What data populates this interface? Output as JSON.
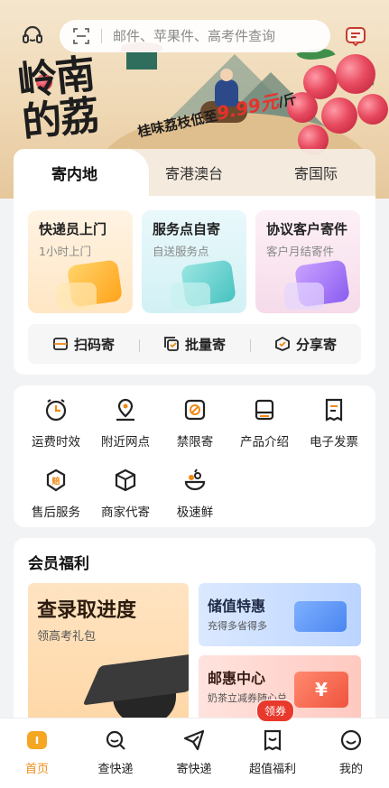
{
  "banner": {
    "title": "岭南的荔",
    "slogan": "桂味荔枝低至",
    "price": "9.99元",
    "unit": "/斤"
  },
  "header": {
    "search_placeholder": "邮件、苹果件、高考件查询",
    "left_icon": "customer-service-icon",
    "right_icon": "message-icon"
  },
  "send_tabs": [
    {
      "label": "寄内地"
    },
    {
      "label": "寄港澳台"
    },
    {
      "label": "寄国际"
    }
  ],
  "services": [
    {
      "title": "快递员上门",
      "subtitle": "1小时上门"
    },
    {
      "title": "服务点自寄",
      "subtitle": "自送服务点"
    },
    {
      "title": "协议客户寄件",
      "subtitle": "客户月结寄件"
    }
  ],
  "quick_actions": [
    {
      "label": "扫码寄",
      "icon": "scan-icon"
    },
    {
      "label": "批量寄",
      "icon": "batch-icon"
    },
    {
      "label": "分享寄",
      "icon": "share-icon"
    }
  ],
  "grid": [
    {
      "label": "运费时效",
      "icon": "clock-icon"
    },
    {
      "label": "附近网点",
      "icon": "location-icon"
    },
    {
      "label": "禁限寄",
      "icon": "prohibited-icon"
    },
    {
      "label": "产品介绍",
      "icon": "box-info-icon"
    },
    {
      "label": "电子发票",
      "icon": "invoice-icon"
    },
    {
      "label": "售后服务",
      "icon": "aftersale-icon",
      "glyph": "赔"
    },
    {
      "label": "商家代寄",
      "icon": "package-icon"
    },
    {
      "label": "极速鲜",
      "icon": "fresh-icon"
    }
  ],
  "member": {
    "title": "会员福利",
    "promo_big": {
      "title": "查录取进度",
      "subtitle": "领高考礼包"
    },
    "promo_small1": {
      "title": "储值特惠",
      "subtitle": "充得多省得多"
    },
    "promo_small2": {
      "title": "邮惠中心",
      "subtitle": "奶茶立减券随心兑",
      "glyph": "¥"
    }
  },
  "nav": [
    {
      "label": "首页",
      "icon": "home-icon"
    },
    {
      "label": "查快递",
      "icon": "search-icon"
    },
    {
      "label": "寄快递",
      "icon": "send-icon"
    },
    {
      "label": "超值福利",
      "icon": "coupon-icon"
    },
    {
      "label": "我的",
      "icon": "profile-icon"
    }
  ],
  "nav_badge": "领券",
  "colors": {
    "accent": "#f08a16",
    "badge": "#e8392c"
  }
}
